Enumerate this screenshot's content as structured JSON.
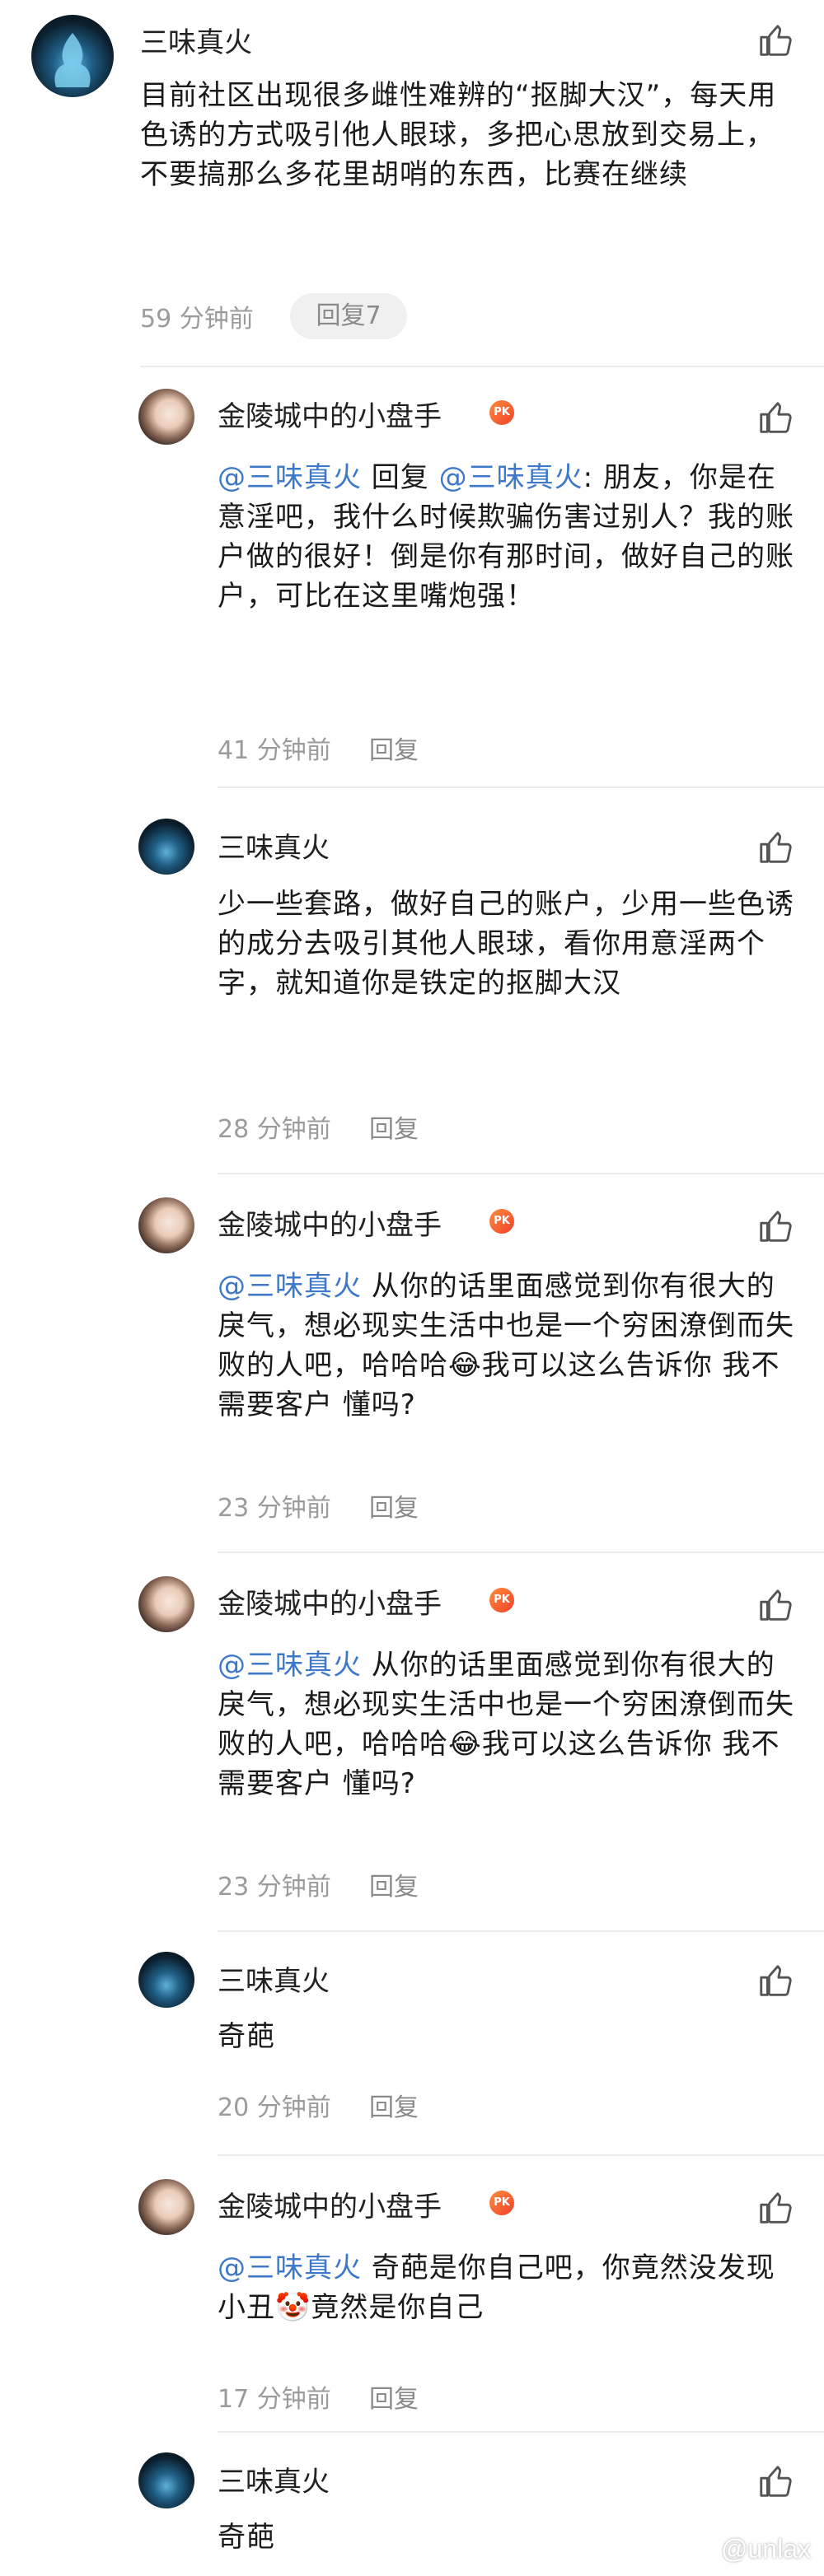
{
  "top": {
    "name": "三味真火",
    "text": "目前社区出现很多雌性难辨的“抠脚大汉”，每天用色诱的方式吸引他人眼球，多把心思放到交易上，不要搞那么多花里胡哨的东西，比赛在继续",
    "time": "59 分钟前",
    "reply_button": "回复7"
  },
  "replies": [
    {
      "name": "金陵城中的小盘手",
      "badge": "PK",
      "mention": "@三味真火",
      "pre": " 回复 ",
      "mention2": "@三味真火",
      "text": ": 朋友，你是在意淫吧，我什么时候欺骗伤害过别人？我的账户做的很好！倒是你有那时间，做好自己的账户，可比在这里嘴炮强！",
      "time": "41 分钟前",
      "reply": "回复"
    },
    {
      "name": "三味真火",
      "text": "少一些套路，做好自己的账户，少用一些色诱的成分去吸引其他人眼球，看你用意淫两个字，就知道你是铁定的抠脚大汉",
      "time": "28 分钟前",
      "reply": "回复"
    },
    {
      "name": "金陵城中的小盘手",
      "badge": "PK",
      "mention": "@三味真火",
      "text": " 从你的话里面感觉到你有很大的戾气，想必现实生活中也是一个穷困潦倒而失败的人吧，哈哈哈😂我可以这么告诉你 我不需要客户 懂吗?",
      "time": "23 分钟前",
      "reply": "回复"
    },
    {
      "name": "金陵城中的小盘手",
      "badge": "PK",
      "mention": "@三味真火",
      "text": " 从你的话里面感觉到你有很大的戾气，想必现实生活中也是一个穷困潦倒而失败的人吧，哈哈哈😂我可以这么告诉你 我不需要客户 懂吗?",
      "time": "23 分钟前",
      "reply": "回复"
    },
    {
      "name": "三味真火",
      "text": "奇葩",
      "time": "20 分钟前",
      "reply": "回复"
    },
    {
      "name": "金陵城中的小盘手",
      "badge": "PK",
      "mention": "@三味真火",
      "text": " 奇葩是你自己吧，你竟然没发现小丑🤡竟然是你自己",
      "time": "17 分钟前",
      "reply": "回复"
    },
    {
      "name": "三味真火",
      "text": "奇葩"
    }
  ],
  "watermark": "@unlax",
  "icons": {
    "like": "thumbs-up-icon",
    "badge": "pk-badge-icon"
  },
  "colors": {
    "mention": "#3d78c9",
    "time": "#9b9b9b",
    "divider": "#ececec"
  }
}
